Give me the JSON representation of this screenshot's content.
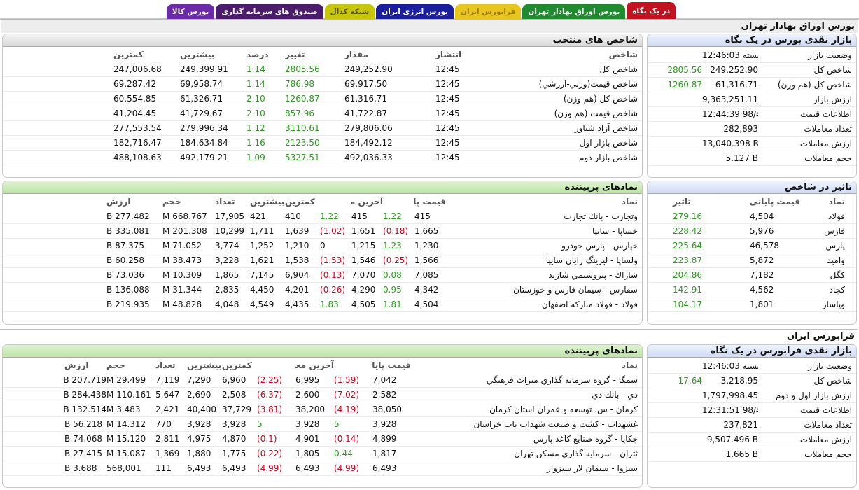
{
  "tabs": [
    {
      "label": "در یک نگاه",
      "bg": "#c0121f",
      "fg": "#ffffff"
    },
    {
      "label": "بورس اوراق بهادار تهران",
      "bg": "#1f8a2e",
      "fg": "#ffffff"
    },
    {
      "label": "فرابورس ایران",
      "bg": "#e8c51f",
      "fg": "#a17a00"
    },
    {
      "label": "بورس انرژی ایران",
      "bg": "#1b1f9c",
      "fg": "#ffffff"
    },
    {
      "label": "شبکه کدال",
      "bg": "#c8c60a",
      "fg": "#555500"
    },
    {
      "label": "صندوق های سرمایه گذاری",
      "bg": "#4a1c6b",
      "fg": "#ffffff"
    },
    {
      "label": "بورس کالا",
      "bg": "#6b2aa8",
      "fg": "#ffffff"
    }
  ],
  "tse": {
    "title": "بورس اوراق بهادار تهران",
    "glance": {
      "title": "بازار نقدی بورس در یک نگاه",
      "rows": [
        {
          "label": "وضعیت بازار",
          "value": "بسته 12:46:03",
          "change": ""
        },
        {
          "label": "شاخص کل",
          "value": "249,252.90",
          "change": "2805.56"
        },
        {
          "label": "شاخص کل (هم وزن)",
          "value": "61,316.71",
          "change": "1260.87"
        },
        {
          "label": "ارزش بازار",
          "value": "9,363,251.115 B",
          "change": ""
        },
        {
          "label": "اطلاعات قیمت",
          "value": "12:44:39 98/4/17",
          "change": ""
        },
        {
          "label": "تعداد معاملات",
          "value": "282,893",
          "change": ""
        },
        {
          "label": "ارزش معاملات",
          "value": "13,040.398 B",
          "change": ""
        },
        {
          "label": "حجم معاملات",
          "value": "5.127 B",
          "change": ""
        }
      ]
    },
    "indices": {
      "title": "شاخص های منتخب",
      "headers": [
        "شاخص",
        "انتشار",
        "مقدار",
        "تغییر",
        "درصد",
        "بیشترین",
        "کمترین"
      ],
      "rows": [
        [
          "شاخص كل",
          "12:45",
          "249,252.90",
          "2805.56",
          "1.14",
          "249,399.91",
          "247,006.68"
        ],
        [
          "شاخص قيمت(وزني-ارزشي)",
          "12:45",
          "69,917.50",
          "786.98",
          "1.14",
          "69,958.74",
          "69,287.42"
        ],
        [
          "شاخص كل (هم وزن)",
          "12:45",
          "61,316.71",
          "1260.87",
          "2.10",
          "61,326.71",
          "60,554.85"
        ],
        [
          "شاخص قيمت (هم وزن)",
          "12:45",
          "41,722.87",
          "857.96",
          "2.10",
          "41,729.67",
          "41,204.45"
        ],
        [
          "شاخص آزاد شناور",
          "12:45",
          "279,806.06",
          "3110.61",
          "1.12",
          "279,996.34",
          "277,553.54"
        ],
        [
          "شاخص بازار اول",
          "12:45",
          "184,492.12",
          "2123.50",
          "1.16",
          "184,634.84",
          "182,716.47"
        ],
        [
          "شاخص بازار دوم",
          "12:45",
          "492,036.33",
          "5327.51",
          "1.09",
          "492,179.21",
          "488,108.63"
        ]
      ]
    },
    "impact": {
      "title": "تاثیر در شاخص",
      "headers": [
        "نماد",
        "قیمت پایانی",
        "تاثیر"
      ],
      "rows": [
        [
          "فولاد",
          "4,504",
          "279.16"
        ],
        [
          "فارس",
          "5,976",
          "228.42"
        ],
        [
          "پارس",
          "46,578",
          "225.64"
        ],
        [
          "وامید",
          "5,872",
          "223.87"
        ],
        [
          "كگل",
          "7,182",
          "204.86"
        ],
        [
          "كچاد",
          "4,562",
          "142.91"
        ],
        [
          "وپاسار",
          "1,801",
          "104.17"
        ]
      ]
    },
    "busiest": {
      "title": "نمادهای پربیننده",
      "headers": [
        "نماد",
        "قیمت پایانی",
        "",
        "آخرین معامله",
        "",
        "کمترین",
        "بیشترین",
        "تعداد",
        "حجم",
        "ارزش"
      ],
      "rows": [
        [
          "وتجارت - بانك تجارت",
          "415",
          "1.22",
          "415",
          "1.22",
          "410",
          "421",
          "17,905",
          "668.767 M",
          "277.482 B"
        ],
        [
          "خساپا - سايپا",
          "1,665",
          "(0.18)",
          "1,651",
          "(1.02)",
          "1,639",
          "1,711",
          "10,299",
          "201.308 M",
          "335.081 B"
        ],
        [
          "خپارس - پارس خودرو",
          "1,230",
          "1.23",
          "1,215",
          "0",
          "1,210",
          "1,252",
          "3,774",
          "71.052 M",
          "87.375 B"
        ],
        [
          "ولساپا - ليزينگ رايان سايپا",
          "1,566",
          "(0.25)",
          "1,546",
          "(1.53)",
          "1,538",
          "1,621",
          "3,228",
          "38.473 M",
          "60.258 B"
        ],
        [
          "شاراك - پتروشيمي شازند",
          "7,085",
          "0.08",
          "7,070",
          "(0.13)",
          "6,904",
          "7,145",
          "1,865",
          "10.309 M",
          "73.036 B"
        ],
        [
          "سفارس - سيمان فارس و خوزستان",
          "4,342",
          "0.95",
          "4,290",
          "(0.26)",
          "4,201",
          "4,450",
          "2,835",
          "31.344 M",
          "136.088 B"
        ],
        [
          "فولاد - فولاد مباركه اصفهان",
          "4,504",
          "1.81",
          "4,505",
          "1.83",
          "4,435",
          "4,549",
          "4,048",
          "48.828 M",
          "219.935 B"
        ]
      ]
    }
  },
  "ifb": {
    "title": "فرابورس ایران",
    "glance": {
      "title": "بازار نقدی فرابورس در یک نگاه",
      "rows": [
        {
          "label": "وضعیت بازار",
          "value": "بسته 12:46:03",
          "change": ""
        },
        {
          "label": "شاخص کل",
          "value": "3,218.95",
          "change": "17.64"
        },
        {
          "label": "ارزش بازار اول و دوم",
          "value": "1,797,998.450 B",
          "change": ""
        },
        {
          "label": "اطلاعات قیمت",
          "value": "12:31:51 98/4/17",
          "change": ""
        },
        {
          "label": "تعداد معاملات",
          "value": "237,821",
          "change": ""
        },
        {
          "label": "ارزش معاملات",
          "value": "9,507.496 B",
          "change": ""
        },
        {
          "label": "حجم معاملات",
          "value": "1.665 B",
          "change": ""
        }
      ]
    },
    "busiest": {
      "title": "نمادهای پربیننده",
      "headers": [
        "نماد",
        "قیمت پایانی",
        "",
        "آخرین معامله",
        "",
        "کمترین",
        "بیشترین",
        "تعداد",
        "حجم",
        "ارزش"
      ],
      "rows": [
        [
          "سمگا - گروه سرمايه گذاري ميراث فرهنگي",
          "7,042",
          "(1.59)",
          "6,995",
          "(2.25)",
          "6,960",
          "7,290",
          "7,119",
          "29.499 M",
          "207.719 B"
        ],
        [
          "دي - بانك دي",
          "2,582",
          "(7.02)",
          "2,600",
          "(6.37)",
          "2,508",
          "2,690",
          "5,647",
          "110.161 M",
          "284.438 B"
        ],
        [
          "كرمان - س. توسعه و عمران استان كرمان",
          "38,050",
          "(4.19)",
          "38,200",
          "(3.81)",
          "37,729",
          "40,400",
          "2,421",
          "3.483 M",
          "132.514 B"
        ],
        [
          "غشهداب - كشت و صنعت شهداب ناب خراسان",
          "3,928",
          "5",
          "3,928",
          "5",
          "3,928",
          "3,928",
          "770",
          "14.312 M",
          "56.218 B"
        ],
        [
          "چكاپا - گروه صنايع كاغذ پارس",
          "4,899",
          "(0.14)",
          "4,901",
          "(0.1)",
          "4,870",
          "4,975",
          "2,811",
          "15.120 M",
          "74.068 B"
        ],
        [
          "ثتران - سرمايه گذاري مسكن تهران",
          "1,817",
          "0.44",
          "1,805",
          "(0.22)",
          "1,775",
          "1,880",
          "1,369",
          "15.087 M",
          "27.415 B"
        ],
        [
          "سبزوا - سيمان لار سبزوار",
          "6,493",
          "(4.99)",
          "6,493",
          "(4.99)",
          "6,493",
          "6,493",
          "111",
          "568,001",
          "3.688 B"
        ]
      ]
    }
  },
  "colors": {
    "up": "#2a9d1f",
    "down": "#d0021b"
  }
}
